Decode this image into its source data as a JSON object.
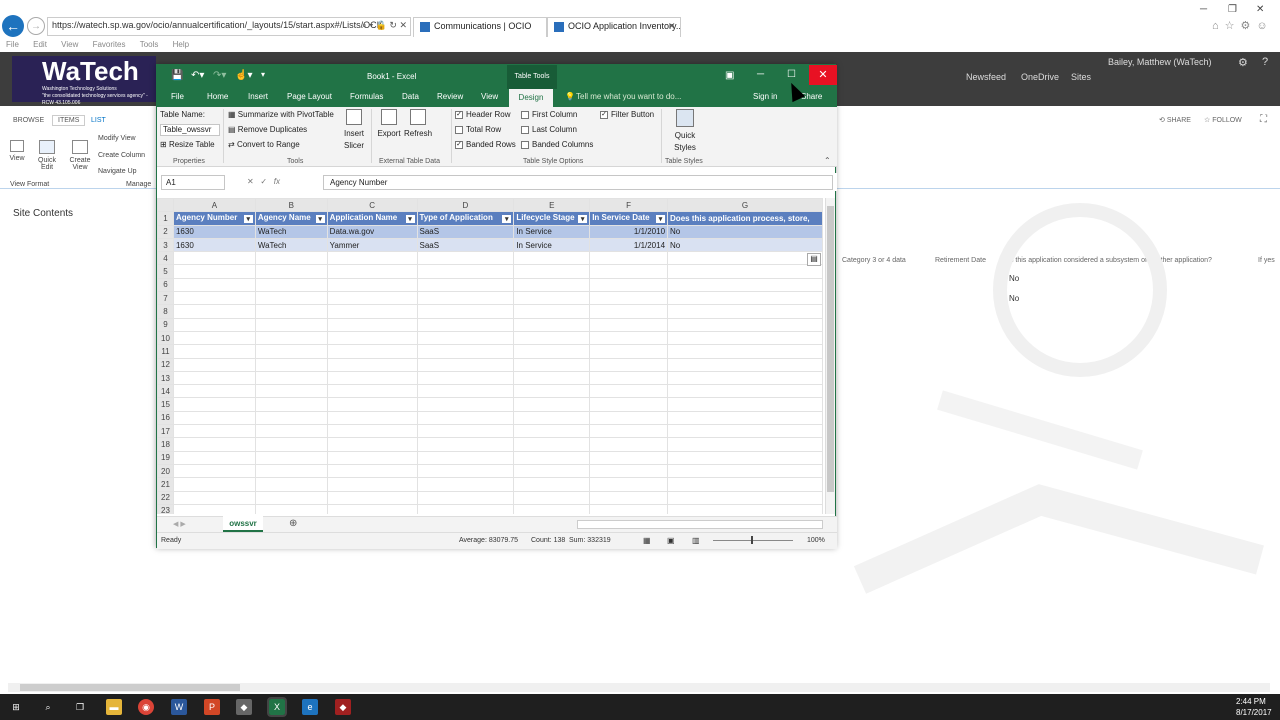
{
  "browser": {
    "url": "https://watech.sp.wa.gov/ocio/annualcertification/_layouts/15/start.aspx#/Lists/OCI(",
    "tabs": [
      {
        "label": "Communications | OCIO"
      },
      {
        "label": "OCIO Application Inventory..."
      }
    ],
    "menu": [
      "File",
      "Edit",
      "View",
      "Favorites",
      "Tools",
      "Help"
    ]
  },
  "sharepoint": {
    "logo_text": "WaTech",
    "logo_sub": "Washington Technology Solutions",
    "logo_tag": "\"the consolidated technology services agency\" - RCW 43.105.006",
    "top_links": [
      "Newsfeed",
      "OneDrive",
      "Sites"
    ],
    "user": "Bailey, Matthew (WaTech)",
    "ribbon_tabs": [
      "BROWSE",
      "ITEMS",
      "LIST"
    ],
    "ribbon_buttons": [
      "View",
      "Quick Edit",
      "Create View",
      "Modify View",
      "Create Column",
      "Navigate Up"
    ],
    "ribbon_groups": [
      "View Format",
      "Manage"
    ],
    "share": "SHARE",
    "follow": "FOLLOW",
    "site_contents": "Site Contents",
    "bg_headers": [
      "Category 3 or 4 data",
      "Retirement Date",
      "Is this application considered a subsystem of another application?",
      "If yes"
    ],
    "bg_values": [
      "No",
      "No"
    ]
  },
  "excel": {
    "title": "Book1 - Excel",
    "context_tab": "Table Tools",
    "tabs": [
      "File",
      "Home",
      "Insert",
      "Page Layout",
      "Formulas",
      "Data",
      "Review",
      "View",
      "Design"
    ],
    "tell_me": "Tell me what you want to do...",
    "sign_in": "Sign in",
    "share": "Share",
    "ribbon": {
      "table_name_label": "Table Name:",
      "table_name_value": "Table_owssvr",
      "resize_table": "Resize Table",
      "properties": "Properties",
      "summarize": "Summarize with PivotTable",
      "remove_duplicates": "Remove Duplicates",
      "convert_to_range": "Convert to Range",
      "tools": "Tools",
      "insert_slicer": "Insert Slicer",
      "export": "Export",
      "refresh": "Refresh",
      "external_table_data": "External Table Data",
      "header_row": "Header Row",
      "total_row": "Total Row",
      "banded_rows": "Banded Rows",
      "first_column": "First Column",
      "last_column": "Last Column",
      "banded_columns": "Banded Columns",
      "filter_button": "Filter Button",
      "table_style_options": "Table Style Options",
      "quick_styles": "Quick Styles",
      "table_styles": "Table Styles"
    },
    "name_box": "A1",
    "formula": "Agency Number",
    "columns": [
      "A",
      "B",
      "C",
      "D",
      "E",
      "F",
      "G"
    ],
    "headers": [
      "Agency Number",
      "Agency Name",
      "Application Name",
      "Type of Application",
      "Lifecycle Stage",
      "In Service Date",
      "Does this application process, store,"
    ],
    "rows": [
      [
        "1630",
        "WaTech",
        "Data.wa.gov",
        "SaaS",
        "In Service",
        "1/1/2010",
        "No"
      ],
      [
        "1630",
        "WaTech",
        "Yammer",
        "SaaS",
        "In Service",
        "1/1/2014",
        "No"
      ]
    ],
    "row_numbers": [
      "1",
      "2",
      "3",
      "4",
      "5",
      "6",
      "7",
      "8",
      "9",
      "10",
      "11",
      "12",
      "13",
      "14",
      "15",
      "16",
      "17",
      "18",
      "19",
      "20",
      "21",
      "22",
      "23"
    ],
    "sheet_tab": "owssvr",
    "status": {
      "ready": "Ready",
      "average": "Average: 83079.75",
      "count": "Count: 138",
      "sum": "Sum: 332319",
      "zoom": "100%"
    }
  },
  "taskbar": {
    "time": "2:44 PM",
    "date": "8/17/2017"
  }
}
